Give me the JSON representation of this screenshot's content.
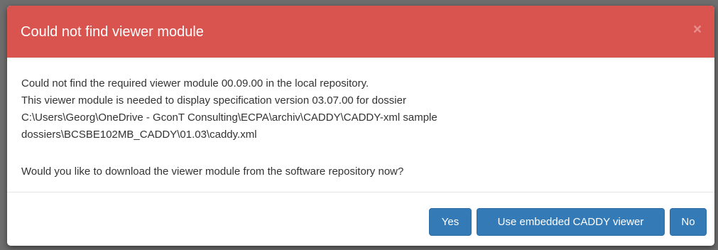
{
  "dialog": {
    "title": "Could not find viewer module",
    "close_label": "×",
    "body": {
      "line1": "Could not find the required viewer module 00.09.00 in the local repository.",
      "line2": "This viewer module is needed to display specification version 03.07.00 for dossier",
      "line3": "C:\\Users\\Georg\\OneDrive - GconT Consulting\\ECPA\\archiv\\CADDY\\CADDY-xml sample",
      "line4": "dossiers\\BCSBE102MB_CADDY\\01.03\\caddy.xml",
      "question": "Would you like to download the viewer module from the software repository now?"
    },
    "buttons": {
      "yes": "Yes",
      "embedded": "Use embedded CADDY viewer",
      "no": "No"
    }
  },
  "colors": {
    "header_bg": "#d9534f",
    "primary_button": "#337ab7",
    "backdrop": "#6e6e6e"
  }
}
